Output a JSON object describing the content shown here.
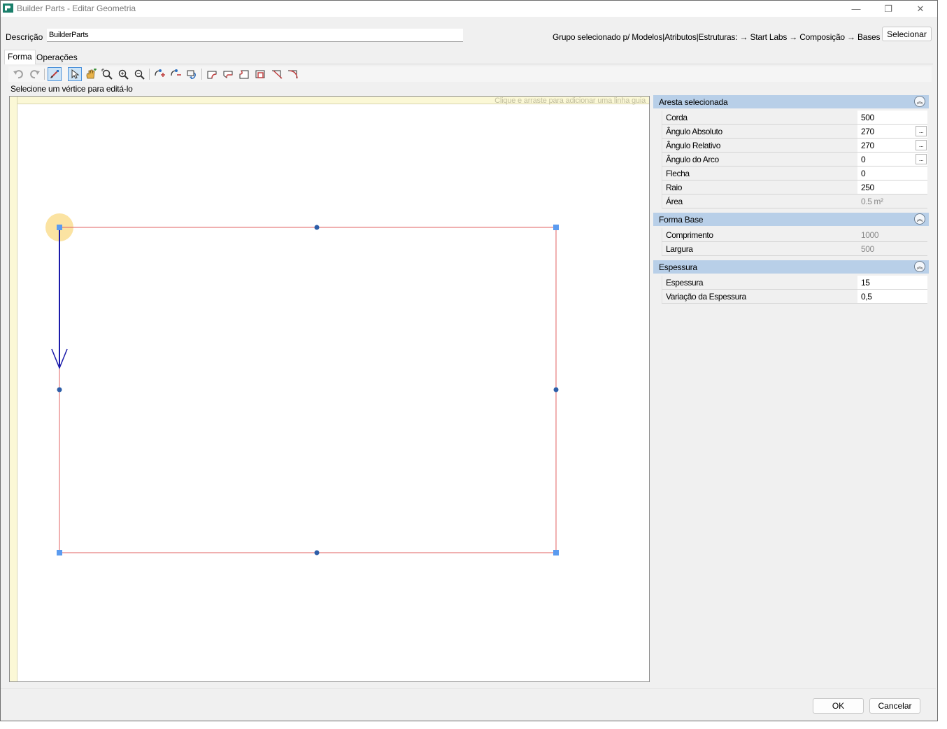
{
  "window": {
    "title": "Builder Parts - Editar Geometria",
    "minimize": "—",
    "maximize": "❐",
    "close": "✕"
  },
  "header": {
    "description_label": "Descrição",
    "description_value": "BuilderParts",
    "group_text": "Grupo selecionado p/ Modelos|Atributos|Estruturas: → Start Labs → Composição → Bases",
    "select_button": "Selecionar"
  },
  "tabs": [
    {
      "label": "Forma",
      "active": true
    },
    {
      "label": "Operações",
      "active": false
    }
  ],
  "toolbar": {
    "icons": [
      "undo-icon",
      "redo-icon",
      "edit-vertex-icon",
      "select-pointer-icon",
      "pan-hand-icon",
      "zoom-fit-icon",
      "zoom-in-icon",
      "zoom-out-icon",
      "add-point-icon",
      "remove-point-icon",
      "rotate-shape-icon",
      "shape-arc-top-icon",
      "shape-arc-bottom-icon",
      "shape-corner-icon",
      "shape-square-icon",
      "shape-chamfer-icon",
      "shape-fillet-icon"
    ]
  },
  "status": "Selecione um vértice para editá-lo",
  "canvas": {
    "guide_hint": "Clique e arraste para adicionar uma linha guia",
    "colors": {
      "edge": "#e06060",
      "vertex": "#5b9bef",
      "midpoint": "#2d5ea8",
      "arrow": "#1a1aaa",
      "highlight": "#fbe3a2"
    }
  },
  "sections": [
    {
      "title": "Aresta selecionada",
      "rows": [
        {
          "name": "Corda",
          "value": "500",
          "readonly": false,
          "ellipsis": false
        },
        {
          "name": "Ângulo Absoluto",
          "value": "270",
          "readonly": false,
          "ellipsis": true
        },
        {
          "name": "Ângulo Relativo",
          "value": "270",
          "readonly": false,
          "ellipsis": true
        },
        {
          "name": "Ângulo do Arco",
          "value": "0",
          "readonly": false,
          "ellipsis": true
        },
        {
          "name": "Flecha",
          "value": "0",
          "readonly": false,
          "ellipsis": false
        },
        {
          "name": "Raio",
          "value": "250",
          "readonly": false,
          "ellipsis": false
        },
        {
          "name": "Área",
          "value": "0.5 m²",
          "readonly": true,
          "ellipsis": false
        }
      ]
    },
    {
      "title": "Forma Base",
      "rows": [
        {
          "name": "Comprimento",
          "value": "1000",
          "readonly": true,
          "ellipsis": false
        },
        {
          "name": "Largura",
          "value": "500",
          "readonly": true,
          "ellipsis": false
        }
      ]
    },
    {
      "title": "Espessura",
      "rows": [
        {
          "name": "Espessura",
          "value": "15",
          "readonly": false,
          "ellipsis": false
        },
        {
          "name": "Variação da Espessura",
          "value": "0,5",
          "readonly": false,
          "ellipsis": false
        }
      ]
    }
  ],
  "footer": {
    "ok": "OK",
    "cancel": "Cancelar"
  }
}
